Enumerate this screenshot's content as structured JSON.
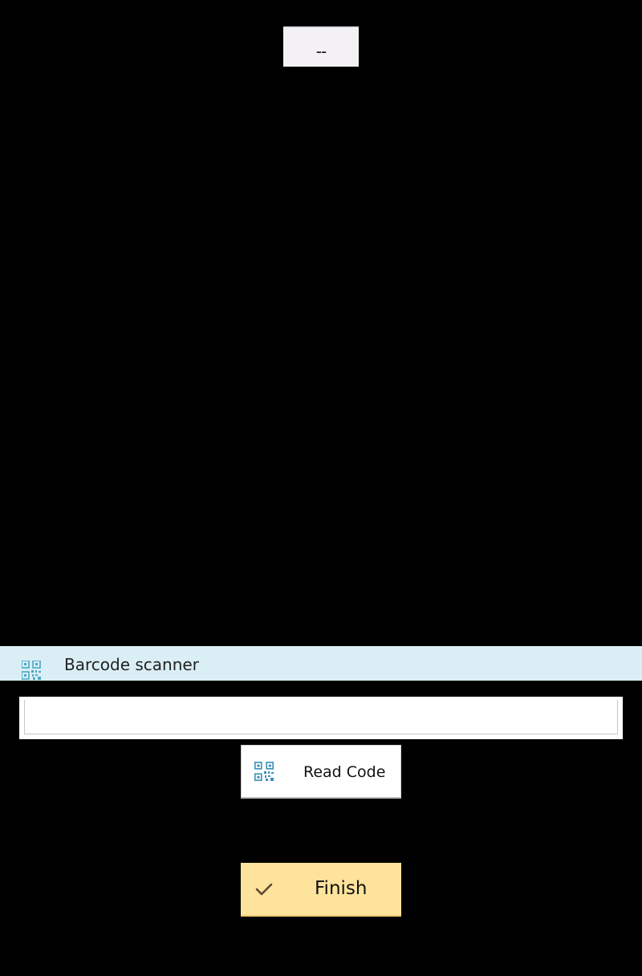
{
  "top_spinner": {
    "value": "--"
  },
  "barcode_section": {
    "title": "Barcode scanner",
    "icon": "qr-code-icon",
    "header_color": "#daeef5"
  },
  "code_input": {
    "value": "",
    "placeholder": ""
  },
  "read_button": {
    "label": "Read Code",
    "icon": "qr-code-icon"
  },
  "finish_button": {
    "label": "Finish",
    "icon": "checkmark-icon",
    "color": "#fde39c"
  }
}
